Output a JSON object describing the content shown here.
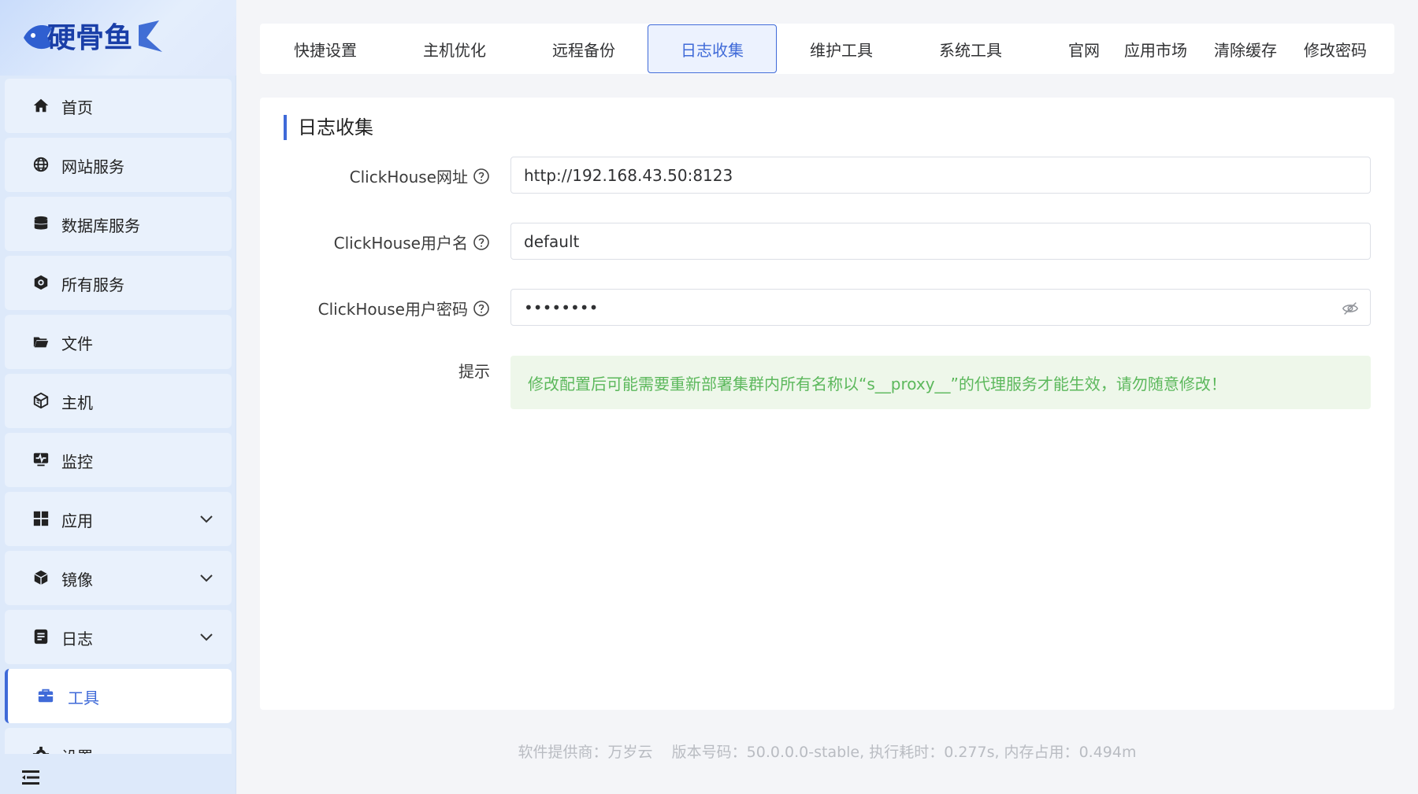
{
  "app": {
    "logo_text": "硬骨鱼"
  },
  "sidebar": {
    "items": [
      {
        "label": "首页",
        "icon": "home-icon"
      },
      {
        "label": "网站服务",
        "icon": "globe-icon"
      },
      {
        "label": "数据库服务",
        "icon": "database-icon"
      },
      {
        "label": "所有服务",
        "icon": "services-icon"
      },
      {
        "label": "文件",
        "icon": "folder-icon"
      },
      {
        "label": "主机",
        "icon": "server-icon"
      },
      {
        "label": "监控",
        "icon": "monitor-icon"
      },
      {
        "label": "应用",
        "icon": "apps-grid-icon",
        "expandable": true
      },
      {
        "label": "镜像",
        "icon": "image-box-icon",
        "expandable": true
      },
      {
        "label": "日志",
        "icon": "log-icon",
        "expandable": true
      },
      {
        "label": "工具",
        "icon": "toolbox-icon",
        "active": true
      },
      {
        "label": "设置",
        "icon": "settings-icon"
      }
    ]
  },
  "tabs": [
    {
      "label": "快捷设置"
    },
    {
      "label": "主机优化"
    },
    {
      "label": "远程备份"
    },
    {
      "label": "日志收集",
      "active": true
    },
    {
      "label": "维护工具"
    },
    {
      "label": "系统工具"
    }
  ],
  "toplinks": [
    {
      "label": "官网"
    },
    {
      "label": "应用市场"
    },
    {
      "label": "清除缓存"
    },
    {
      "label": "修改密码"
    }
  ],
  "panel": {
    "title": "日志收集",
    "fields": {
      "url": {
        "label": "ClickHouse网址",
        "value": "http://192.168.43.50:8123"
      },
      "username": {
        "label": "ClickHouse用户名",
        "value": "default"
      },
      "password": {
        "label": "ClickHouse用户密码",
        "value": "••••••••"
      }
    },
    "tip": {
      "label": "提示",
      "text": "修改配置后可能需要重新部署集群内所有名称以“s__proxy__”的代理服务才能生效，请勿随意修改！"
    }
  },
  "footer": {
    "text": "软件提供商：万岁云    版本号码：50.0.0.0-stable, 执行耗时：0.277s, 内存占用：0.494m"
  },
  "colors": {
    "accent": "#3f6ad8",
    "sidebar_bg": "#dde9fa",
    "tip_green": "#5cb85c",
    "tip_bg": "#eef7ea"
  }
}
